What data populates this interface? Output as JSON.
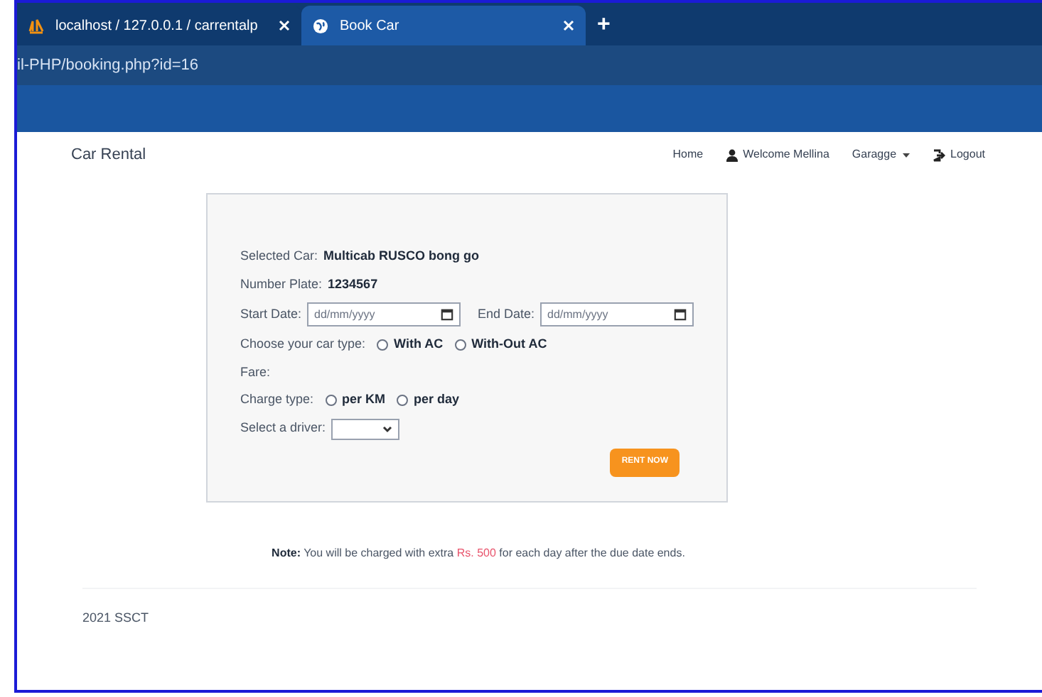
{
  "browser": {
    "tabs": [
      {
        "title": "localhost / 127.0.0.1 / carrentalp",
        "selected": false
      },
      {
        "title": "Book Car",
        "selected": true
      }
    ],
    "new_tab": "+",
    "address": "il-PHP/booking.php?id=16"
  },
  "navbar": {
    "brand": "Car Rental",
    "links": [
      {
        "label": "Home",
        "kind": "plain"
      },
      {
        "label": "Welcome Mellina",
        "kind": "user"
      },
      {
        "label": "Garagge",
        "kind": "dropdown"
      },
      {
        "label": "Logout",
        "kind": "logout"
      }
    ]
  },
  "form": {
    "selected_car_label": "Selected Car:",
    "selected_car": "Multicab RUSCO bong go",
    "plate_label": "Number Plate:",
    "plate": "1234567",
    "start_label": "Start Date:",
    "start_placeholder": "dd/mm/yyyy",
    "end_label": "End Date:",
    "end_placeholder": "dd/mm/yyyy",
    "car_type_label": "Choose your car type:",
    "car_types": [
      {
        "label": "With AC",
        "selected": false
      },
      {
        "label": "With-Out AC",
        "selected": false
      }
    ],
    "fare_label": "Fare:",
    "charge_label": "Charge type:",
    "charge_types": [
      {
        "label": "per KM",
        "selected": false
      },
      {
        "label": "per day",
        "selected": false
      }
    ],
    "driver_label": "Select a driver:",
    "submit": "RENT NOW"
  },
  "note": {
    "label": "Note:",
    "before": "You will be charged with extra",
    "amount": "Rs. 500",
    "after": "for each day after the due date ends."
  },
  "footer": "2021 SSCT"
}
